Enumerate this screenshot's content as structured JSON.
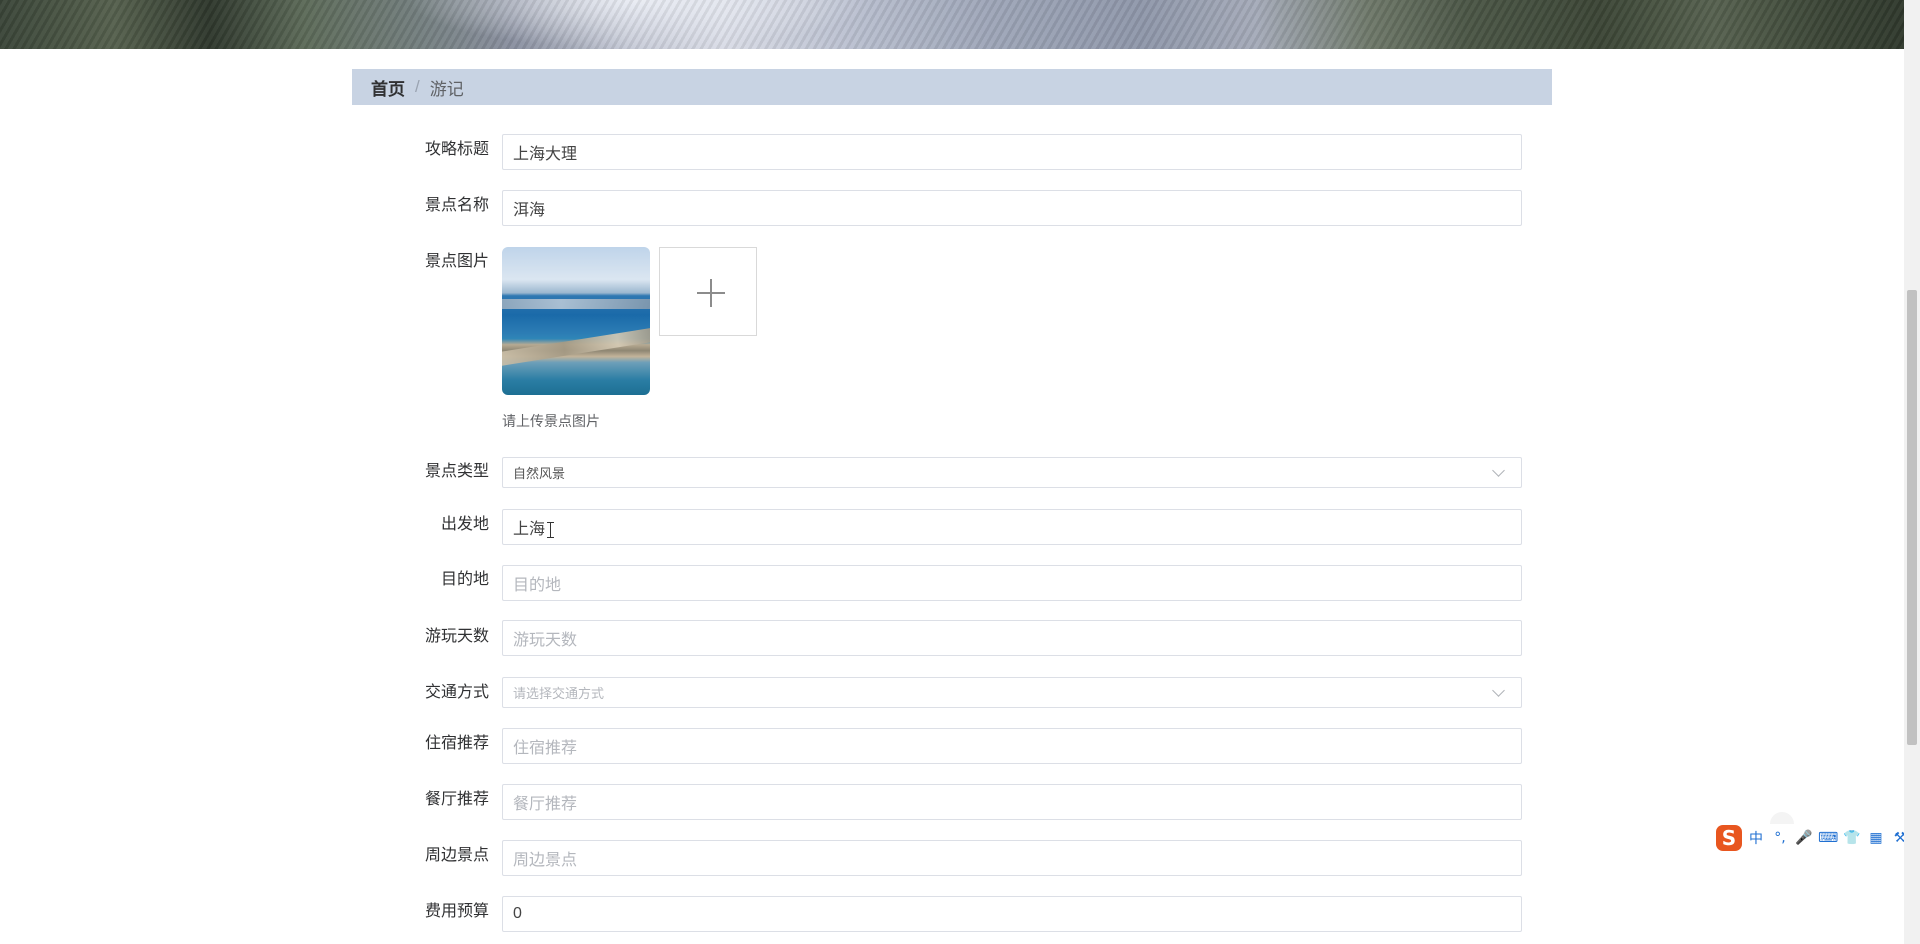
{
  "breadcrumb": {
    "home": "首页",
    "separator": "/",
    "current": "游记"
  },
  "form": {
    "title": {
      "label": "攻略标题",
      "value": "上海大理"
    },
    "spot_name": {
      "label": "景点名称",
      "value": "洱海"
    },
    "spot_image": {
      "label": "景点图片",
      "hint": "请上传景点图片"
    },
    "spot_type": {
      "label": "景点类型",
      "value": "自然风景"
    },
    "departure": {
      "label": "出发地",
      "value": "上海"
    },
    "destination": {
      "label": "目的地",
      "placeholder": "目的地"
    },
    "days": {
      "label": "游玩天数",
      "placeholder": "游玩天数"
    },
    "transport": {
      "label": "交通方式",
      "placeholder": "请选择交通方式"
    },
    "lodging": {
      "label": "住宿推荐",
      "placeholder": "住宿推荐"
    },
    "restaurant": {
      "label": "餐厅推荐",
      "placeholder": "餐厅推荐"
    },
    "nearby": {
      "label": "周边景点",
      "placeholder": "周边景点"
    },
    "budget": {
      "label": "费用预算",
      "value": "0"
    }
  },
  "ime_toolbar": {
    "logo": "S",
    "mode": "中",
    "punct": "°,",
    "icons": [
      "mic-icon",
      "keyboard-icon",
      "shirt-icon",
      "apps-icon",
      "tools-icon"
    ]
  }
}
